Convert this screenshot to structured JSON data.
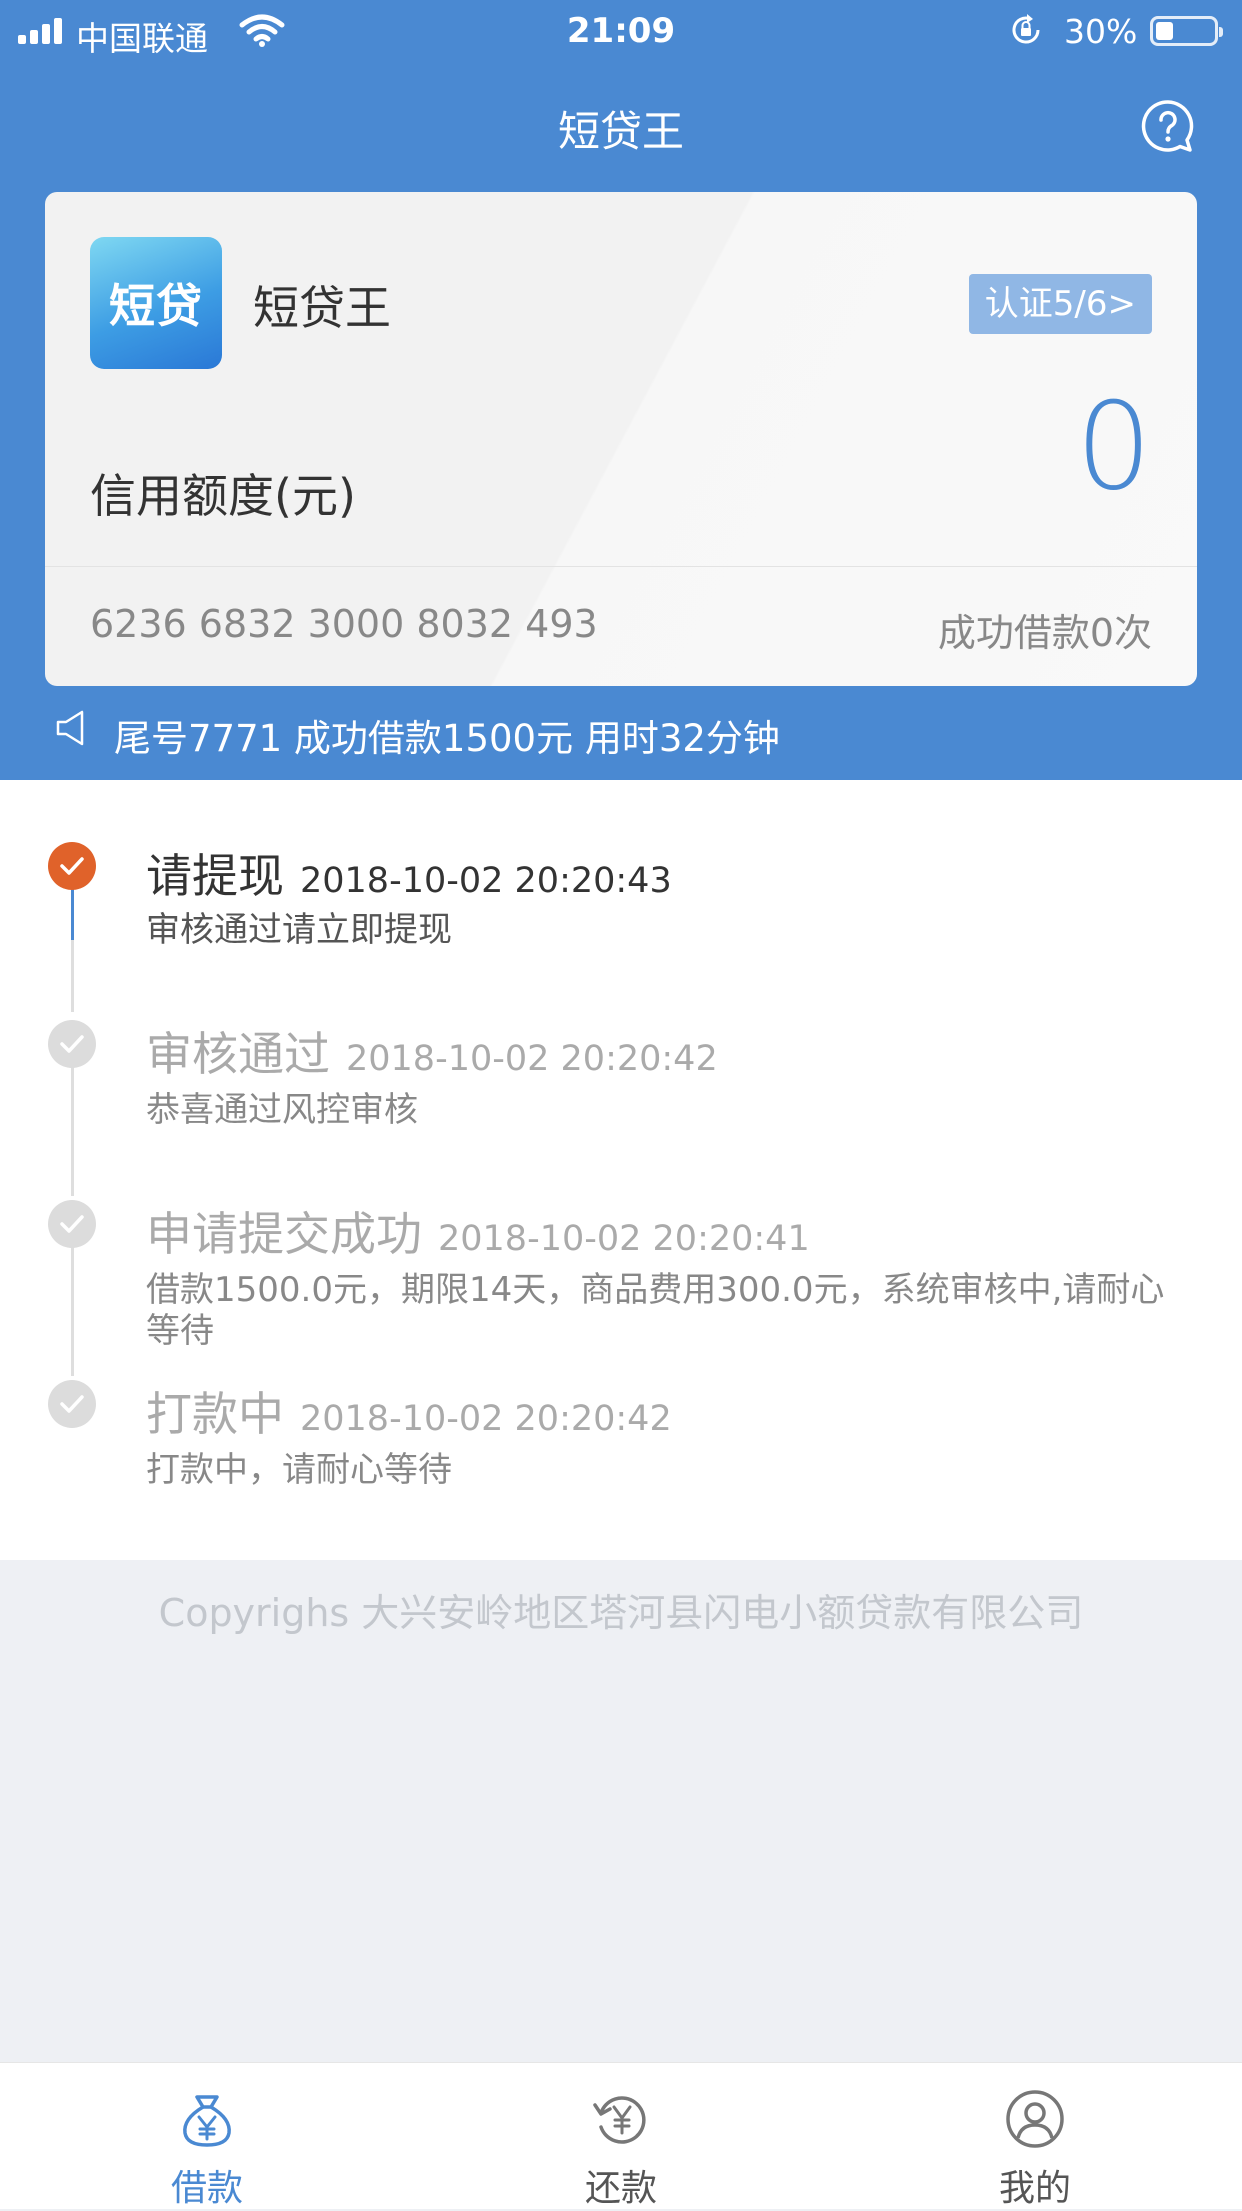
{
  "status_bar": {
    "carrier": "中国联通",
    "time": "21:09",
    "battery": "30%",
    "battery_level": 0.3
  },
  "nav": {
    "title": "短贷王",
    "help_icon": "question-bubble-icon"
  },
  "card": {
    "logo_text": "短贷",
    "app_name": "短贷王",
    "cert_label": "认证5/6>",
    "credit_label": "信用额度(元)",
    "credit_value": "0",
    "card_number": "6236 6832 3000 8032 493",
    "success_count": "成功借款0次"
  },
  "notice": {
    "icon": "speaker-icon",
    "text": "尾号7771 成功借款1500元 用时32分钟"
  },
  "timeline": [
    {
      "title": "请提现",
      "time": "2018-10-02 20:20:43",
      "desc": "审核通过请立即提现",
      "active": true
    },
    {
      "title": "审核通过",
      "time": "2018-10-02 20:20:42",
      "desc": "恭喜通过风控审核",
      "active": false
    },
    {
      "title": "申请提交成功",
      "time": "2018-10-02 20:20:41",
      "desc": "借款1500.0元，期限14天，商品费用300.0元，系统审核中,请耐心等待",
      "active": false
    },
    {
      "title": "打款中",
      "time": "2018-10-02 20:20:42",
      "desc": "打款中，请耐心等待",
      "active": false
    }
  ],
  "footer": {
    "copyright": "Copyrighs 大兴安岭地区塔河县闪电小额贷款有限公司"
  },
  "tabbar": {
    "active_color": "#4a89d2",
    "items": [
      {
        "label": "借款",
        "icon": "money-bag-icon",
        "active": true
      },
      {
        "label": "还款",
        "icon": "repay-icon",
        "active": false
      },
      {
        "label": "我的",
        "icon": "user-icon",
        "active": false
      }
    ]
  },
  "colors": {
    "primary": "#4a89d2",
    "timeline_active": "#e0622a"
  }
}
